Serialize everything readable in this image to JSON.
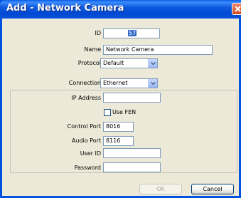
{
  "window": {
    "title": "Add - Network Camera"
  },
  "form": {
    "id": {
      "label": "ID",
      "value": "57"
    },
    "name": {
      "label": "Name",
      "value": "Network Camera"
    },
    "protocol": {
      "label": "Protocol",
      "value": "Default"
    },
    "connection": {
      "label": "Connection",
      "value": "Ethernet"
    },
    "ip_address": {
      "label": "IP Address",
      "value": ""
    },
    "use_fen": {
      "label": "Use FEN",
      "checked": false
    },
    "control_port": {
      "label": "Control Port",
      "value": "8016"
    },
    "audio_port": {
      "label": "Audio Port",
      "value": "8116"
    },
    "user_id": {
      "label": "User ID",
      "value": ""
    },
    "password": {
      "label": "Password",
      "value": ""
    }
  },
  "buttons": {
    "ok": "OK",
    "cancel": "Cancel"
  },
  "colors": {
    "title_bar": "#0053e1",
    "dialog_bg": "#ece9d8",
    "selection": "#316ac5",
    "close_button": "#d24a21"
  }
}
